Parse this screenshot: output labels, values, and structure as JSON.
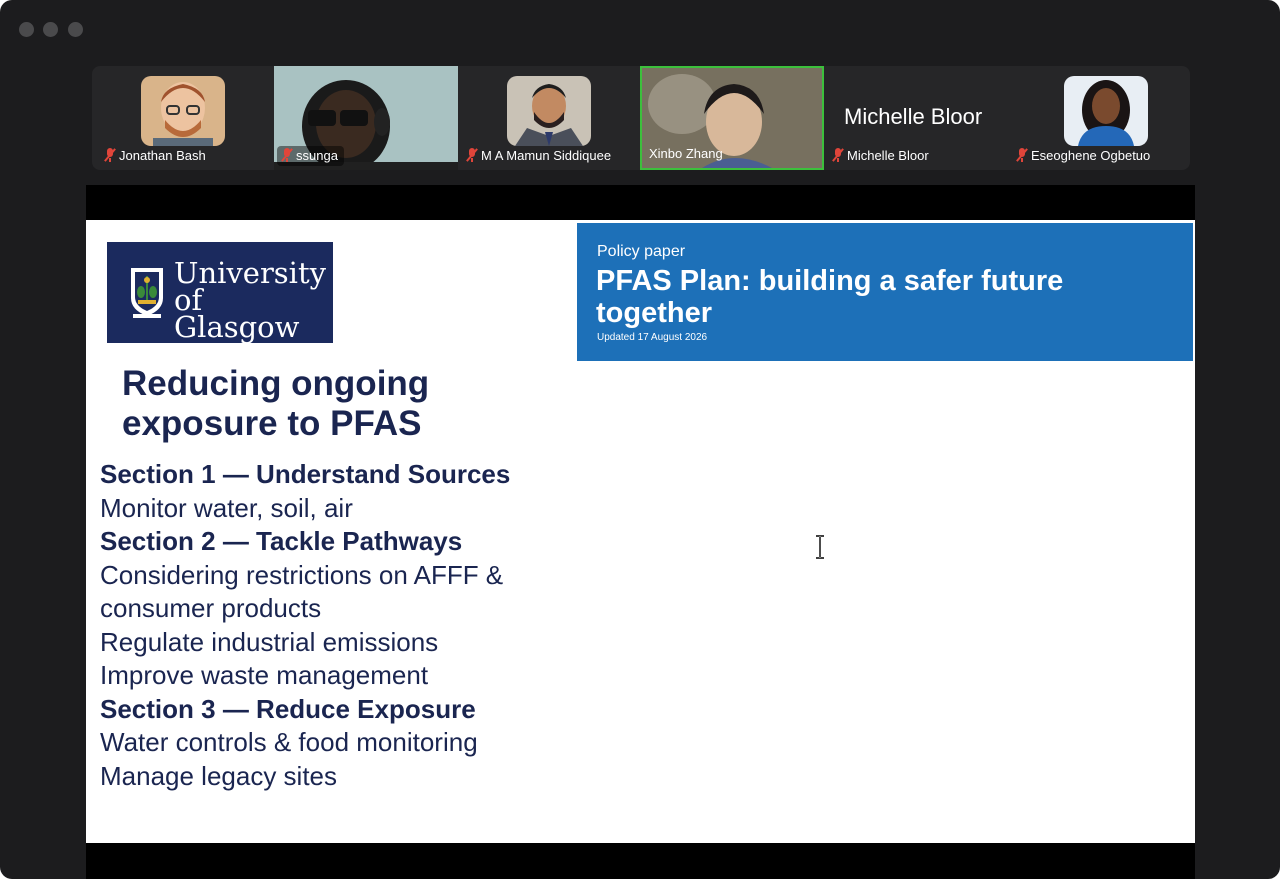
{
  "participants": [
    {
      "name": "Jonathan Bash",
      "muted": true
    },
    {
      "name": "ssunga",
      "muted": true
    },
    {
      "name": "M A Mamun Siddiquee",
      "muted": true
    },
    {
      "name": "Xinbo Zhang",
      "muted": false,
      "active_speaker": true
    },
    {
      "name": "Michelle Bloor",
      "muted": true,
      "display_text": "Michelle Bloor"
    },
    {
      "name": "Eseoghene Ogbetuo",
      "muted": true
    }
  ],
  "slide": {
    "logo": {
      "line1": "University",
      "line2": "of Glasgow"
    },
    "title": "Reducing ongoing exposure to PFAS",
    "sections": [
      {
        "heading": "Section 1 — Understand Sources",
        "items": [
          "Monitor water, soil, air"
        ]
      },
      {
        "heading": "Section 2 — Tackle Pathways",
        "items": [
          "Considering restrictions on AFFF & consumer products",
          "Regulate industrial emissions",
          "Improve waste management"
        ]
      },
      {
        "heading": "Section 3 — Reduce Exposure",
        "items": [
          "Water controls & food monitoring",
          "Manage legacy sites"
        ]
      }
    ],
    "banner": {
      "eyebrow": "Policy paper",
      "headline": "PFAS Plan: building a safer future together",
      "updated": "Updated 17 August 2026"
    }
  },
  "colors": {
    "window_bg": "#1c1c1e",
    "active_speaker_border": "#3cc03c",
    "mic_muted": "#e0453a",
    "logo_navy": "#1b2a5e",
    "gov_blue": "#1d70b8",
    "slide_text": "#1a2550"
  }
}
